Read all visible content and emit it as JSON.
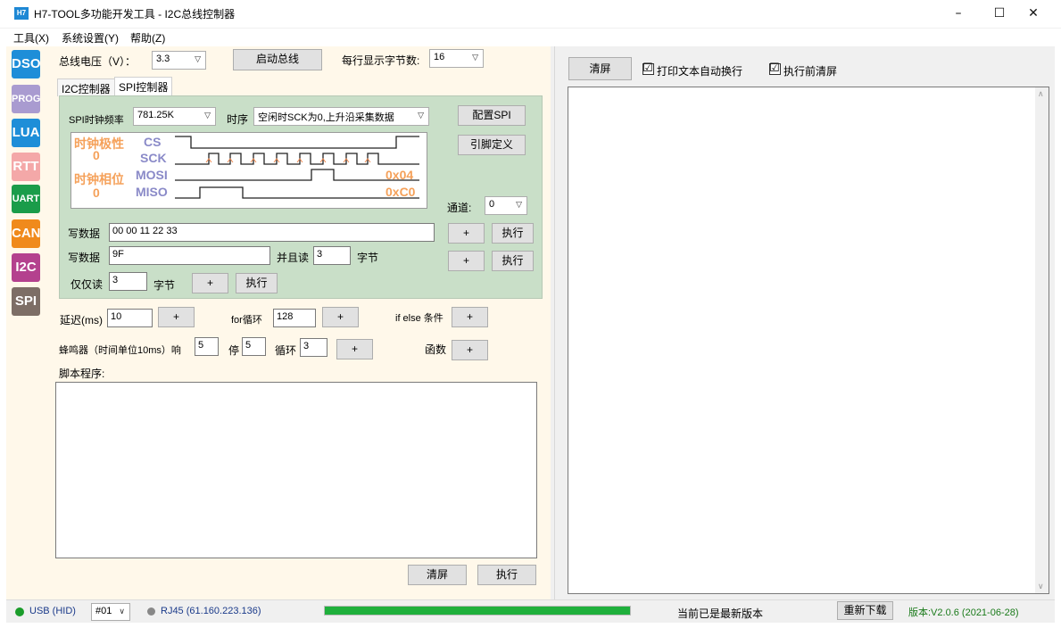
{
  "window": {
    "icon_label": "H7",
    "title": "H7-TOOL多功能开发工具 - I2C总线控制器",
    "minimize": "–",
    "maximize": "☐",
    "close": "✕"
  },
  "menu": [
    "工具(X)",
    "系统设置(Y)",
    "帮助(Z)"
  ],
  "sidebar": [
    {
      "label": "DSO",
      "color": "#1e8ed8"
    },
    {
      "label": "PROG",
      "color": "#a99bd0"
    },
    {
      "label": "LUA",
      "color": "#1e8ed8"
    },
    {
      "label": "RTT",
      "color": "#f4a8a8"
    },
    {
      "label": "UART",
      "color": "#1a9c4a"
    },
    {
      "label": "CAN",
      "color": "#f08a1c"
    },
    {
      "label": "I2C",
      "color": "#b4418e"
    },
    {
      "label": "SPI",
      "color": "#7d6e66"
    }
  ],
  "top_controls": {
    "bus_voltage_label": "总线电压（V）：",
    "bus_voltage_value": "3.3",
    "start_bus_button": "启动总线",
    "bytes_per_line_label": "每行显示字节数:",
    "bytes_per_line_value": "16"
  },
  "tabs": [
    {
      "label": "I2C控制器",
      "active": false
    },
    {
      "label": "SPI控制器",
      "active": true
    }
  ],
  "spi": {
    "clock_label": "SPI时钟频率",
    "clock_value": "781.25K",
    "timing_label": "时序",
    "timing_value": "空闲时SCK为0,上升沿采集数据",
    "config_button": "配置SPI",
    "pin_define_button": "引脚定义",
    "diagram": {
      "polarity_label": "时钟极性",
      "polarity_value": "0",
      "phase_label": "时钟相位",
      "phase_value": "0",
      "signal_cs": "CS",
      "signal_sck": "SCK",
      "signal_mosi": "MOSI",
      "signal_miso": "MISO",
      "mosi_hex": "0x04",
      "miso_hex": "0xC0"
    },
    "channel_label": "通道:",
    "channel_value": "0",
    "write1_label": "写数据",
    "write1_value": "00 00 11 22 33",
    "write1_plus": "+",
    "write1_exec": "执行",
    "write2_label": "写数据",
    "write2_value": "9F",
    "read_and_label": "并且读",
    "read_and_value": "3",
    "bytes_label": "字节",
    "write2_plus": "+",
    "write2_exec": "执行",
    "read_only_label": "仅仅读",
    "read_only_value": "3",
    "read_only_bytes_label": "字节",
    "read_only_plus": "+",
    "read_only_exec": "执行"
  },
  "script_controls": {
    "delay_label": "延迟(ms)",
    "delay_value": "10",
    "delay_plus": "+",
    "for_label": "for循环",
    "for_value": "128",
    "for_plus": "+",
    "ifelse_label": "if else 条件",
    "ifelse_plus": "+",
    "buzzer_label": "蜂鸣器（时间单位10ms）响",
    "buzzer_on_value": "5",
    "buzzer_stop_label": "停",
    "buzzer_stop_value": "5",
    "buzzer_loop_label": "循环",
    "buzzer_loop_value": "3",
    "buzzer_plus": "+",
    "function_label": "函数",
    "function_plus": "+",
    "script_label": "脚本程序:",
    "clear_button": "清屏",
    "exec_button": "执行"
  },
  "output": {
    "clear_button": "清屏",
    "auto_wrap_label": "打印文本自动换行",
    "clear_before_exec_label": "执行前清屏",
    "auto_wrap_checked": "☑",
    "clear_before_checked": "☑"
  },
  "statusbar": {
    "usb_label": "USB (HID)",
    "device_value": "#01",
    "rj45_label": "RJ45 (61.160.223.136)",
    "progress_fraction": 1.0,
    "update_status": "当前已是最新版本",
    "redownload_button": "重新下载",
    "version": "版本:V2.0.6 (2021-06-28)",
    "usb_color": "#1a9c2a",
    "rj45_color": "#888888",
    "progress_color": "#1fb03c"
  }
}
